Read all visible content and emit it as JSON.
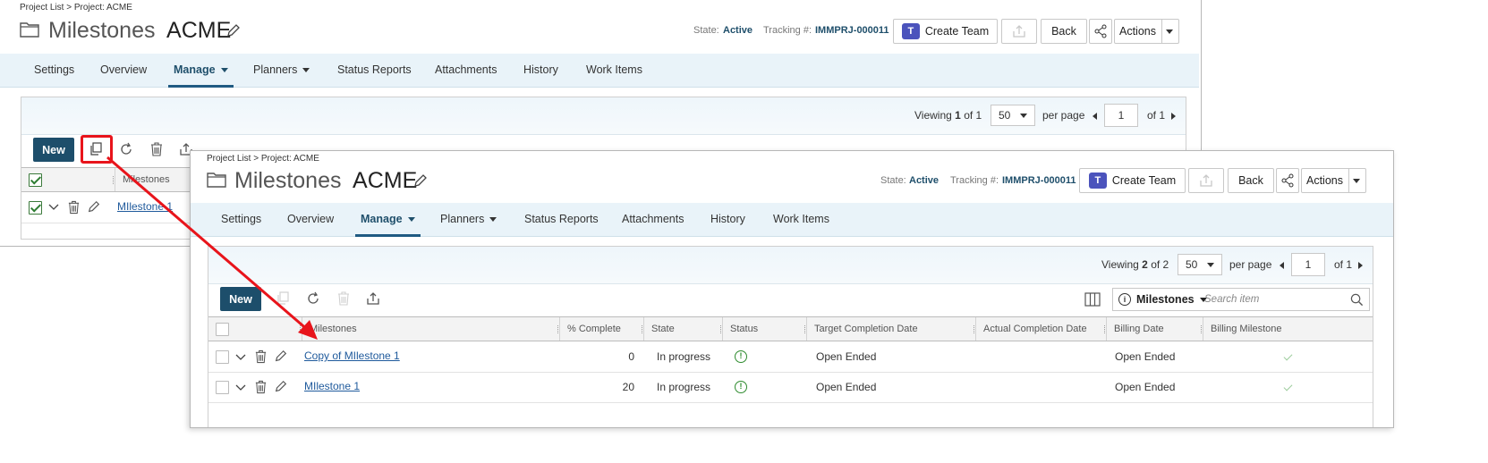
{
  "common": {
    "breadcrumb": "Project List > Project: ACME",
    "title_prefix": "Milestones",
    "title_project": "ACME",
    "state_label": "State:",
    "state_value": "Active",
    "tracking_label": "Tracking #:",
    "tracking_value": "IMMPRJ-000011",
    "create_team_label": "Create Team",
    "back_label": "Back",
    "actions_label": "Actions",
    "tabs": [
      {
        "label": "Settings"
      },
      {
        "label": "Overview"
      },
      {
        "label": "Manage"
      },
      {
        "label": "Planners"
      },
      {
        "label": "Status Reports"
      },
      {
        "label": "Attachments"
      },
      {
        "label": "History"
      },
      {
        "label": "Work Items"
      }
    ],
    "new_label": "New",
    "per_page": "50",
    "per_page_label": "per page",
    "page_num": "1",
    "of_pages": "of 1",
    "viewing_prefix": "Viewing",
    "search_scope": "Milestones",
    "search_placeholder": "Search item"
  },
  "back_window": {
    "viewing_current": "1",
    "viewing_total": "of 1",
    "column_header": "Milestones",
    "row_name": "MIlestone 1"
  },
  "front_window": {
    "viewing_current": "2",
    "viewing_total": "of 2",
    "columns": [
      "Milestones",
      "% Complete",
      "State",
      "Status",
      "Target Completion Date",
      "Actual Completion Date",
      "Billing Date",
      "Billing Milestone"
    ],
    "rows": [
      {
        "name": "Copy of MIlestone 1",
        "complete": "0",
        "state": "In progress",
        "target": "Open Ended",
        "billing_date": "Open Ended"
      },
      {
        "name": "MIlestone 1",
        "complete": "20",
        "state": "In progress",
        "target": "Open Ended",
        "billing_date": "Open Ended"
      }
    ]
  },
  "colors": {
    "highlight": "#e8141b",
    "accent": "#1d4e6b",
    "link": "#1f5a9c",
    "status_ok": "#2e8b2e"
  }
}
